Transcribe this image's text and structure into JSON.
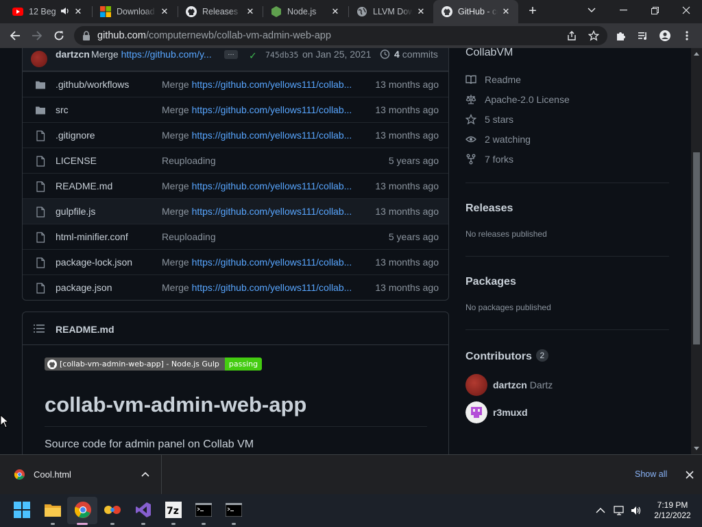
{
  "browser": {
    "tabs": [
      {
        "label": "12 Beg",
        "icon": "youtube-icon"
      },
      {
        "label": "Download",
        "icon": "microsoft-icon"
      },
      {
        "label": "Releases · c",
        "icon": "github-icon"
      },
      {
        "label": "Node.js",
        "icon": "nodejs-icon"
      },
      {
        "label": "LLVM Down",
        "icon": "globe-icon"
      },
      {
        "label": "GitHub - co",
        "icon": "github-icon",
        "active": true
      }
    ],
    "url_host": "github.com",
    "url_path": "/computernewb/collab-vm-admin-web-app"
  },
  "repo": {
    "latest_commit": {
      "author": "dartzcn",
      "message_prefix": "Merge",
      "message_link": "https://github.com/y...",
      "sha": "745db35",
      "date": "on Jan 25, 2021",
      "commits_count": "4",
      "commits_label": "commits"
    },
    "files": [
      {
        "type": "dir",
        "name": ".github/",
        "name_rest": "workflows",
        "msg_prefix": "Merge",
        "msg_link": "https://github.com/yellows111/collab...",
        "age": "13 months ago"
      },
      {
        "type": "dir",
        "name": "src",
        "name_rest": "",
        "msg_prefix": "Merge",
        "msg_link": "https://github.com/yellows111/collab...",
        "age": "13 months ago"
      },
      {
        "type": "file",
        "name": ".gitignore",
        "name_rest": "",
        "msg_prefix": "Merge",
        "msg_link": "https://github.com/yellows111/collab...",
        "age": "13 months ago"
      },
      {
        "type": "file",
        "name": "LICENSE",
        "name_rest": "",
        "msg_prefix": "Reuploading",
        "msg_link": "",
        "age": "5 years ago"
      },
      {
        "type": "file",
        "name": "README.md",
        "name_rest": "",
        "msg_prefix": "Merge",
        "msg_link": "https://github.com/yellows111/collab...",
        "age": "13 months ago"
      },
      {
        "type": "file",
        "name": "gulpfile.js",
        "name_rest": "",
        "msg_prefix": "Merge",
        "msg_link": "https://github.com/yellows111/collab...",
        "age": "13 months ago"
      },
      {
        "type": "file",
        "name": "html-minifier.conf",
        "name_rest": "",
        "msg_prefix": "Reuploading",
        "msg_link": "",
        "age": "5 years ago"
      },
      {
        "type": "file",
        "name": "package-lock.json",
        "name_rest": "",
        "msg_prefix": "Merge",
        "msg_link": "https://github.com/yellows111/collab...",
        "age": "13 months ago"
      },
      {
        "type": "file",
        "name": "package.json",
        "name_rest": "",
        "msg_prefix": "Merge",
        "msg_link": "https://github.com/yellows111/collab...",
        "age": "13 months ago"
      }
    ],
    "readme": {
      "header": "README.md",
      "badge_left": "[collab-vm-admin-web-app] - Node.js Gulp",
      "badge_right": "passing",
      "title": "collab-vm-admin-web-app",
      "description": "Source code for admin panel on Collab VM"
    },
    "sidebar": {
      "about_text": "CollabVM",
      "readme": "Readme",
      "license": "Apache-2.0 License",
      "stars": "5 stars",
      "watching": "2 watching",
      "forks": "7 forks",
      "releases_title": "Releases",
      "releases_empty": "No releases published",
      "packages_title": "Packages",
      "packages_empty": "No packages published",
      "contributors_title": "Contributors",
      "contributors_count": "2",
      "contributors": [
        {
          "login": "dartzcn",
          "name": "Dartz"
        },
        {
          "login": "r3muxd",
          "name": ""
        }
      ]
    }
  },
  "downloads": {
    "file": "Cool.html",
    "show_all": "Show all"
  },
  "taskbar": {
    "time": "7:19 PM",
    "date": "2/12/2022"
  },
  "colors": {
    "accent_link": "#58a6ff",
    "bg": "#0d1117",
    "badge_pass": "#44cc11"
  }
}
